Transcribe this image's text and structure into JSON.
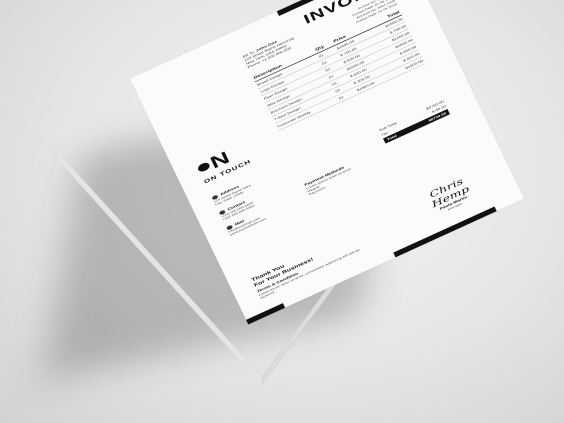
{
  "invoice": {
    "title": "INVOICE",
    "meta": [
      "Invoice No: 0000123",
      "Invoice Date: 01 05 2018",
      "Account No: 0001 2345",
      "Invoice Date: 01 05 2018"
    ],
    "bill_to": {
      "label": "Bill To:",
      "name": "John Doe",
      "lines": [
        "123 Street Name Here/City",
        "New York, USA 10001",
        "Phone: +1 000 000 000"
      ]
    },
    "brand": {
      "logo": "N",
      "name": "ON TOUCH"
    },
    "sidebar": [
      {
        "label": "Address",
        "icon": "pin-icon",
        "lines": [
          "123 Street Name Here",
          "City, State 12345"
        ]
      },
      {
        "label": "Contact",
        "icon": "phone-icon",
        "lines": [
          "+000 000 000 0000",
          "+000 000 000 0000"
        ]
      },
      {
        "label": "Mail",
        "icon": "mail-icon",
        "lines": [
          "info@yourmail.com",
          "www.yourwebsite.com"
        ]
      }
    ],
    "table": {
      "headers": [
        "Description",
        "Qty",
        "Price",
        "Total"
      ],
      "rows": [
        [
          "Brand Design",
          "01",
          "$1500.00",
          "$1500.00"
        ],
        [
          "Logo Design",
          "01",
          "$ 700.00",
          "$ 700.00"
        ],
        [
          "Flyer Design",
          "02",
          "$ 500.00",
          "$1000.00"
        ],
        [
          "Web Design",
          "01",
          "$2500.00",
          "$2500.00"
        ],
        [
          "Brochure Design",
          "01",
          "$ 650.00",
          "$ 650.00"
        ],
        [
          "T-Shirt Design",
          "02",
          "$ 300.00",
          "$ 600.00"
        ],
        [
          "Corporate Identity",
          "01",
          "$1800.00",
          "$1800.00"
        ]
      ]
    },
    "totals": {
      "sub_label": "Sub Total",
      "sub_value": "$8750.00",
      "tax_label": "Tax",
      "tax_value": "$ 00.00",
      "total_label": "Total",
      "total_value": "$8750.00"
    },
    "payment": {
      "label": "Payment Methods",
      "lines": [
        "Lorem ipsum dolor sit amet",
        "Paypal:",
        "Payoneer:"
      ]
    },
    "thanks": [
      "Thank You",
      "For Your Business!"
    ],
    "terms": {
      "label": "Terms & Condition",
      "text": "Lorem ipsum dolor sit amet, consectetur adipiscing elit sed do eiusmod."
    },
    "signature": {
      "script": "Chris Hemp",
      "name": "Paula Martin",
      "role": "Manager"
    }
  }
}
